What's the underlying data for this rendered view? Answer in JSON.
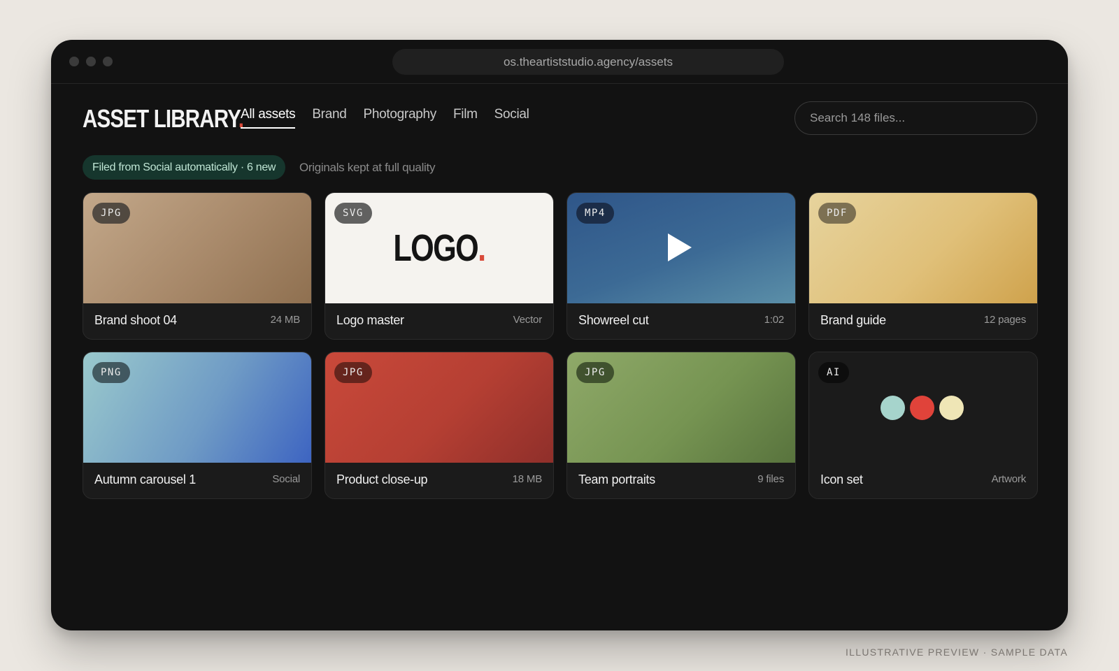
{
  "browser": {
    "url": "os.theartiststudio.agency/assets"
  },
  "header": {
    "logo_text": "ASSET LIBRARY",
    "logo_accent": ".",
    "accent_color": "#d94a3a",
    "tabs": [
      {
        "label": "All assets",
        "active": true
      },
      {
        "label": "Brand",
        "active": false
      },
      {
        "label": "Photography",
        "active": false
      },
      {
        "label": "Film",
        "active": false
      },
      {
        "label": "Social",
        "active": false
      }
    ],
    "search_placeholder": "Search 148 files..."
  },
  "status": {
    "notice": "Filed from Social automatically · 6 new",
    "note": "Originals kept at full quality"
  },
  "assets": [
    {
      "badge": "JPG",
      "title": "Brand shoot 04",
      "meta": "24 MB"
    },
    {
      "badge": "SVG",
      "title": "Logo master",
      "meta": "Vector",
      "thumb_text": "LOGO",
      "thumb_accent": "."
    },
    {
      "badge": "MP4",
      "title": "Showreel cut",
      "meta": "1:02",
      "thumb_icon": "play-icon"
    },
    {
      "badge": "PDF",
      "title": "Brand guide",
      "meta": "12 pages"
    },
    {
      "badge": "PNG",
      "title": "Autumn carousel 1",
      "meta": "Social"
    },
    {
      "badge": "JPG",
      "title": "Product close-up",
      "meta": "18 MB"
    },
    {
      "badge": "JPG",
      "title": "Team portraits",
      "meta": "9 files"
    },
    {
      "badge": "AI",
      "title": "Icon set",
      "meta": "Artwork",
      "swatches": [
        "#a6d4cc",
        "#e0433a",
        "#efe6b6"
      ]
    }
  ],
  "footer": {
    "caption": "ILLUSTRATIVE PREVIEW · SAMPLE DATA"
  }
}
